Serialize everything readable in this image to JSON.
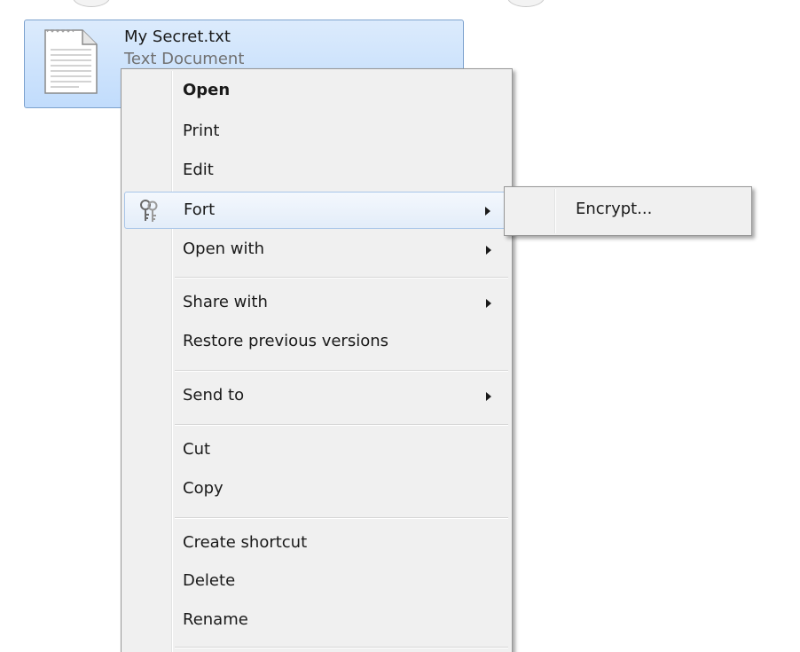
{
  "file": {
    "name": "My Secret.txt",
    "type": "Text Document",
    "icon": "text-document-icon"
  },
  "context_menu": {
    "items": [
      {
        "label": "Open",
        "bold": true
      },
      {
        "label": "Print"
      },
      {
        "label": "Edit"
      },
      {
        "label": "Fort",
        "icon": "keys-icon",
        "submenu": true,
        "highlighted": true
      },
      {
        "label": "Open with",
        "submenu": true
      },
      {
        "label": "Share with",
        "submenu": true
      },
      {
        "label": "Restore previous versions"
      },
      {
        "label": "Send to",
        "submenu": true
      },
      {
        "label": "Cut"
      },
      {
        "label": "Copy"
      },
      {
        "label": "Create shortcut"
      },
      {
        "label": "Delete"
      },
      {
        "label": "Rename"
      }
    ]
  },
  "submenu": {
    "parent": "Fort",
    "items": [
      {
        "label": "Encrypt..."
      }
    ]
  },
  "colors": {
    "selection": "#c1dcfc",
    "selection_border": "#7da2ce",
    "menu_background": "#f0f0f0",
    "menu_border": "#979797",
    "hover_border": "#a8c5e8"
  }
}
